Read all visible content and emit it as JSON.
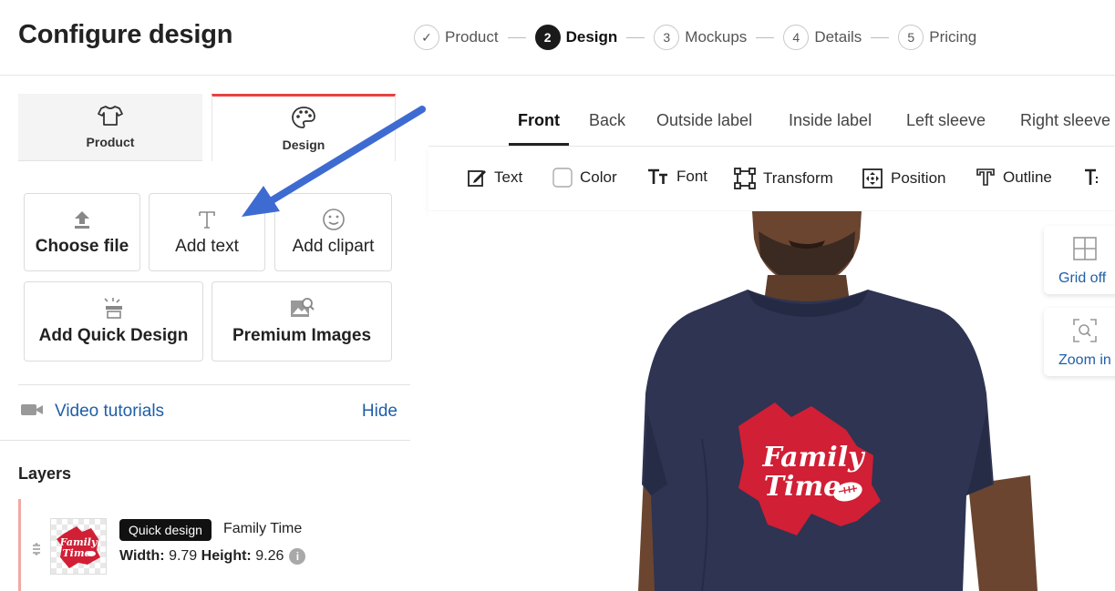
{
  "header": {
    "title": "Configure design",
    "steps": [
      {
        "num": "✓",
        "label": "Product"
      },
      {
        "num": "2",
        "label": "Design"
      },
      {
        "num": "3",
        "label": "Mockups"
      },
      {
        "num": "4",
        "label": "Details"
      },
      {
        "num": "5",
        "label": "Pricing"
      }
    ]
  },
  "left_panel": {
    "tabs": [
      {
        "label": "Product",
        "icon": "tshirt-icon"
      },
      {
        "label": "Design",
        "icon": "palette-icon"
      }
    ],
    "tools": {
      "choose_file": "Choose file",
      "add_text": "Add text",
      "add_clipart": "Add clipart",
      "add_quick_design": "Add Quick Design",
      "premium_images": "Premium Images"
    },
    "video_tutorials": "Video tutorials",
    "hide": "Hide",
    "layers_title": "Layers",
    "layer": {
      "badge": "Quick design",
      "name": "Family Time",
      "width_label": "Width:",
      "width_value": "9.79",
      "height_label": "Height:",
      "height_value": "9.26",
      "thumb_text_line1": "Family",
      "thumb_text_line2": "Time"
    }
  },
  "view_tabs": [
    "Front",
    "Back",
    "Outside label",
    "Inside label",
    "Left sleeve",
    "Right sleeve"
  ],
  "toolbar": {
    "text": "Text",
    "color": "Color",
    "font": "Font",
    "transform": "Transform",
    "position": "Position",
    "outline": "Outline"
  },
  "canvas": {
    "print_line1": "Family",
    "print_line2": "Time"
  },
  "side_buttons": {
    "grid": "Grid off",
    "zoom": "Zoom in"
  },
  "colors": {
    "accent_red": "#e5433f",
    "link_blue": "#1f5ea8",
    "shirt_navy": "#2e3452",
    "print_red": "#d11f35",
    "arrow_blue": "#3e6bd1"
  }
}
